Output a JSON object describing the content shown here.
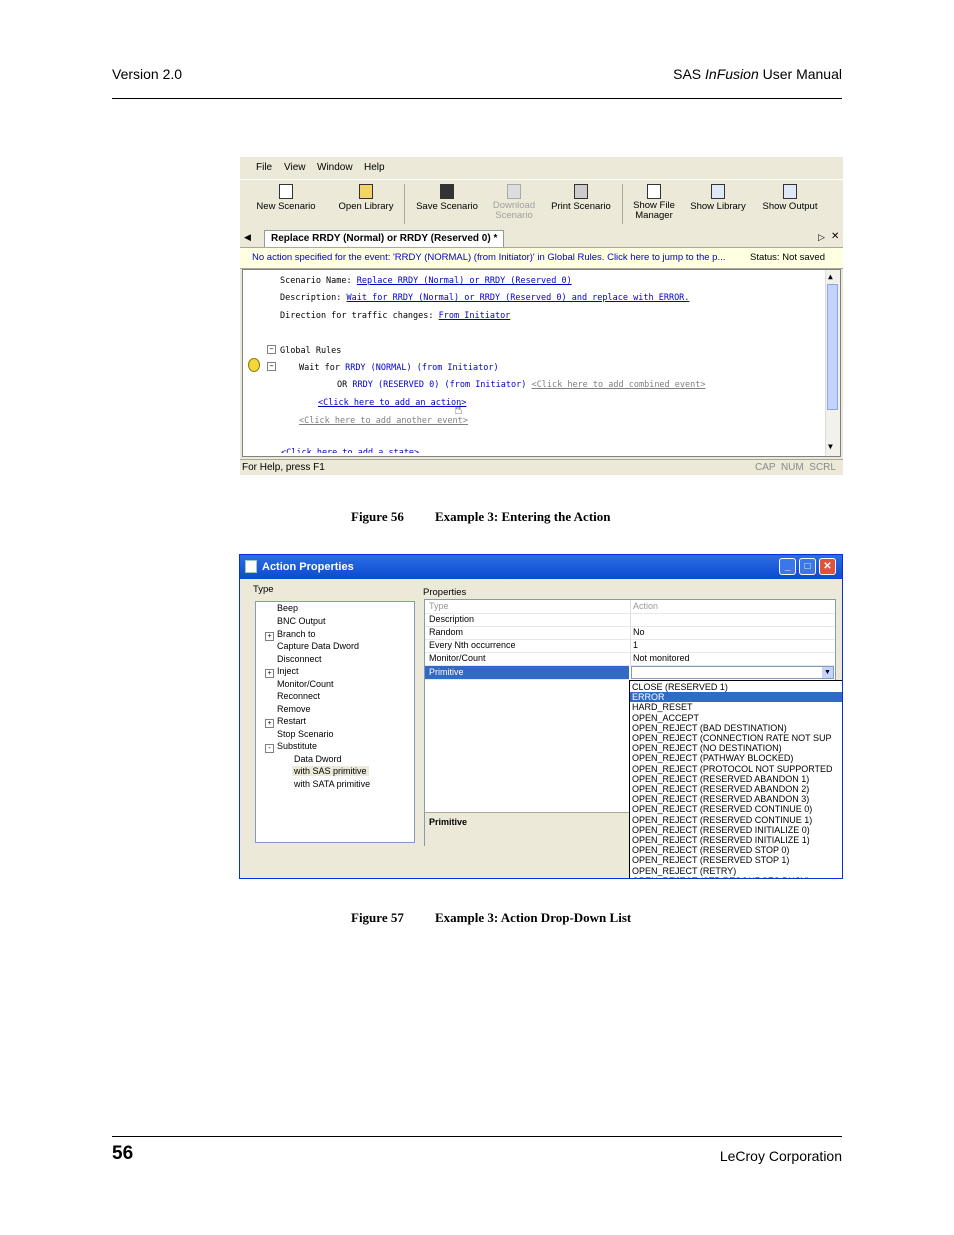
{
  "header": {
    "version": "Version 2.0",
    "manual_prefix": "SAS ",
    "manual_product": "InFusion",
    "manual_suffix": " User Manual"
  },
  "footer": {
    "page_number": "56",
    "company": "LeCroy Corporation"
  },
  "figure56": {
    "caption_num": "Figure 56",
    "caption_text": "Example 3: Entering the Action",
    "menu": [
      "File",
      "View",
      "Window",
      "Help"
    ],
    "toolbar": [
      "New Scenario",
      "Open Library",
      "Save Scenario",
      "Download Scenario",
      "Print Scenario",
      "Show File Manager",
      "Show Library",
      "Show Output"
    ],
    "tab_label": "Replace RRDY (Normal) or RRDY (Reserved 0) *",
    "info_message": "No action specified for the event: 'RRDY (NORMAL) (from Initiator)' in Global Rules.  Click here to jump to the p...",
    "status_label": "Status: Not saved",
    "editor": {
      "scenario_name_label": "Scenario Name:",
      "scenario_name_value": "Replace RRDY (Normal) or RRDY (Reserved 0)",
      "description_label": "Description:",
      "description_value": "Wait for RRDY (Normal) or RRDY (Reserved 0) and replace with ERROR.",
      "direction_label": "Direction for traffic changes:",
      "direction_value": "From Initiator",
      "global_rules": "Global Rules",
      "wait_for": "Wait for",
      "wait_event": "RRDY (NORMAL) (from Initiator)",
      "or": "OR",
      "or_event": "RRDY (RESERVED 0) (from Initiator)",
      "add_combined": "<Click here to add combined event>",
      "add_action": "<Click here to add an action>",
      "add_another": "<Click here to add another event>",
      "add_state": "<Click here to add a state>"
    },
    "statusbar_help": "For Help, press F1",
    "statusbar_indicators": "CAP  NUM  SCRL"
  },
  "figure57": {
    "caption_num": "Figure 57",
    "caption_text": "Example 3: Action Drop-Down List",
    "title": "Action Properties",
    "type_label": "Type",
    "properties_label": "Properties",
    "tree": [
      {
        "label": "Beep",
        "expander": ""
      },
      {
        "label": "BNC Output",
        "expander": ""
      },
      {
        "label": "Branch to",
        "expander": "+"
      },
      {
        "label": "Capture Data Dword",
        "expander": ""
      },
      {
        "label": "Disconnect",
        "expander": ""
      },
      {
        "label": "Inject",
        "expander": "+"
      },
      {
        "label": "Monitor/Count",
        "expander": ""
      },
      {
        "label": "Reconnect",
        "expander": ""
      },
      {
        "label": "Remove",
        "expander": ""
      },
      {
        "label": "Restart",
        "expander": "+"
      },
      {
        "label": "Stop Scenario",
        "expander": ""
      },
      {
        "label": "Substitute",
        "expander": "-"
      },
      {
        "label": "Data Dword",
        "expander": ""
      },
      {
        "label": "with SAS primitive",
        "expander": ""
      },
      {
        "label": "with SATA primitive",
        "expander": ""
      }
    ],
    "properties": [
      {
        "name": "Type",
        "value": "Action"
      },
      {
        "name": "Description",
        "value": ""
      },
      {
        "name": "Random",
        "value": "No"
      },
      {
        "name": "Every Nth occurrence",
        "value": "1"
      },
      {
        "name": "Monitor/Count",
        "value": "Not monitored"
      },
      {
        "name": "Primitive",
        "value": ""
      }
    ],
    "description_box_title": "Primitive",
    "dropdown_options": [
      "CLOSE (RESERVED 1)",
      "ERROR",
      "HARD_RESET",
      "OPEN_ACCEPT",
      "OPEN_REJECT (BAD DESTINATION)",
      "OPEN_REJECT (CONNECTION RATE NOT SUP",
      "OPEN_REJECT (NO DESTINATION)",
      "OPEN_REJECT (PATHWAY BLOCKED)",
      "OPEN_REJECT (PROTOCOL NOT SUPPORTED",
      "OPEN_REJECT (RESERVED ABANDON 1)",
      "OPEN_REJECT (RESERVED ABANDON 2)",
      "OPEN_REJECT (RESERVED ABANDON 3)",
      "OPEN_REJECT (RESERVED CONTINUE 0)",
      "OPEN_REJECT (RESERVED CONTINUE 1)",
      "OPEN_REJECT (RESERVED INITIALIZE 0)",
      "OPEN_REJECT (RESERVED INITIALIZE 1)",
      "OPEN_REJECT (RESERVED STOP 0)",
      "OPEN_REJECT (RESERVED STOP 1)",
      "OPEN_REJECT (RETRY)",
      "OPEN_REJECT (STP RESOURCES BUSY)"
    ],
    "dropdown_selected": "ERROR",
    "colors": {
      "titlebar": "#0a4bd0",
      "selection": "#316ac5"
    }
  }
}
